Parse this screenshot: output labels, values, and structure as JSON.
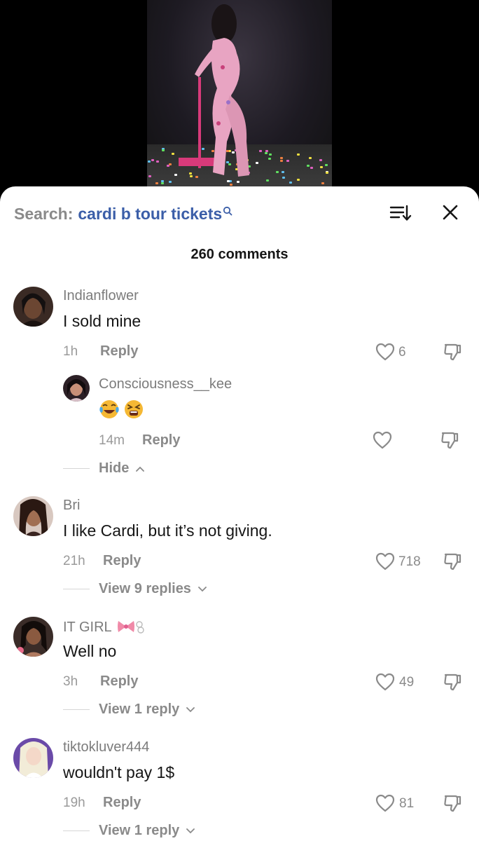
{
  "header": {
    "search_prefix": "Search:",
    "search_term": "cardi b tour tickets",
    "sort_icon": "sort-icon",
    "close_icon": "close-icon",
    "comment_count": "260 comments"
  },
  "colors": {
    "link_blue": "#3b5ea8",
    "muted": "#8a8a8a",
    "text": "#161616"
  },
  "comments": [
    {
      "user": "Indianflower",
      "text": "I sold mine",
      "time": "1h",
      "reply_label": "Reply",
      "likes": "6",
      "replies": [
        {
          "user": "Consciousness__kee",
          "emojis": [
            "face-with-tears-of-joy",
            "tired-face"
          ],
          "time": "14m",
          "reply_label": "Reply"
        }
      ],
      "thread_label": "Hide"
    },
    {
      "user": "Bri",
      "text": "I like Cardi, but it’s not giving.",
      "time": "21h",
      "reply_label": "Reply",
      "likes": "718",
      "thread_label": "View 9 replies"
    },
    {
      "user": "IT GIRL",
      "text": "Well no",
      "time": "3h",
      "reply_label": "Reply",
      "likes": "49",
      "thread_label": "View 1 reply"
    },
    {
      "user": "tiktokluver444",
      "text": "wouldn't pay 1$",
      "time": "19h",
      "reply_label": "Reply",
      "likes": "81",
      "thread_label": "View 1 reply"
    }
  ]
}
